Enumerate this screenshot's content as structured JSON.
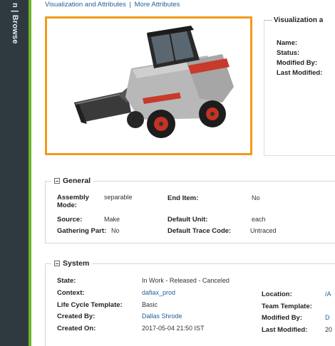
{
  "nav": {
    "label": "n | Browse"
  },
  "links": {
    "visualization": "Visualization and Attributes",
    "separator": "|",
    "more": "More Attributes"
  },
  "viz_info": {
    "title": "Visualization a",
    "rows": [
      "Name:",
      "Status:",
      "Modified By:",
      "Last Modified:"
    ]
  },
  "general": {
    "title": "General",
    "assembly_mode_label": "Assembly Mode:",
    "assembly_mode_value": "separable",
    "end_item_label": "End Item:",
    "end_item_value": "No",
    "source_label": "Source:",
    "source_value": "Make",
    "default_unit_label": "Default Unit:",
    "default_unit_value": "each",
    "gathering_part_label": "Gathering Part:",
    "gathering_part_value": "No",
    "default_trace_code_label": "Default Trace Code:",
    "default_trace_code_value": "Untraced"
  },
  "system": {
    "title": "System",
    "state_label": "State:",
    "state_value": "In Work - Released - Canceled",
    "context_label": "Context:",
    "context_value": "dafiax_prod",
    "location_label": "Location:",
    "location_value": "/A",
    "lifecycle_label": "Life Cycle Template:",
    "lifecycle_value": "Basic",
    "team_template_label": "Team Template:",
    "team_template_value": "",
    "created_by_label": "Created By:",
    "created_by_value": "Dallas Shrode",
    "modified_by_label": "Modified By:",
    "modified_by_value": "D",
    "created_on_label": "Created On:",
    "created_on_value": "2017-05-04 21:50 IST",
    "last_modified_label": "Last Modified:",
    "last_modified_value": "20"
  },
  "colors": {
    "nav": "#2e3a40",
    "accent": "#6fb52c",
    "frame": "#f39a1c",
    "link": "#1f5f99"
  },
  "icons": [
    "section-toggle-icon",
    "skid-steer-loader-image"
  ]
}
